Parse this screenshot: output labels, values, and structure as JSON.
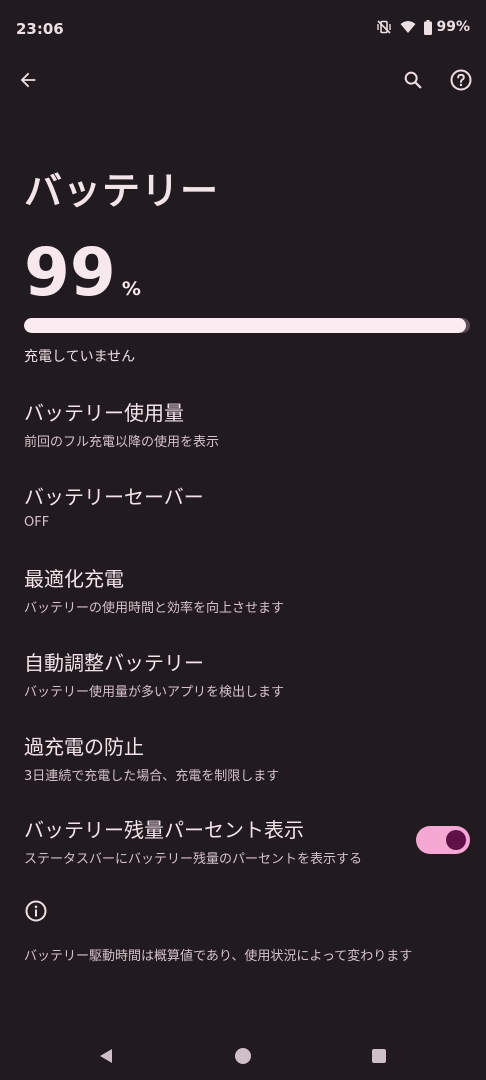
{
  "status_bar": {
    "time": "23:06",
    "battery_percent": "99%",
    "icons": [
      "vibrate-off-icon",
      "wifi-icon",
      "battery-icon"
    ]
  },
  "app_bar": {
    "icons": [
      "back-arrow-icon",
      "search-icon",
      "help-icon"
    ]
  },
  "page": {
    "title": "バッテリー",
    "battery_level": "99",
    "battery_unit": "%",
    "battery_fraction": 0.99,
    "charging_status": "充電していません"
  },
  "settings": [
    {
      "title": "バッテリー使用量",
      "subtitle": "前回のフル充電以降の使用を表示"
    },
    {
      "title": "バッテリーセーバー",
      "subtitle": "OFF"
    },
    {
      "title": "最適化充電",
      "subtitle": "バッテリーの使用時間と効率を向上させます"
    },
    {
      "title": "自動調整バッテリー",
      "subtitle": "バッテリー使用量が多いアプリを検出します"
    },
    {
      "title": "過充電の防止",
      "subtitle": "3日連続で充電した場合、充電を制限します"
    },
    {
      "title": "バッテリー残量パーセント表示",
      "subtitle": "ステータスバーにバッテリー残量のパーセントを表示する",
      "toggle_on": true
    }
  ],
  "footer": {
    "text": "バッテリー駆動時間は概算値であり、使用状況によって変わります"
  },
  "colors": {
    "background": "#211a1e",
    "toggle_track": "#f5a8d4",
    "toggle_knob": "#5f1148",
    "bar_fill": "#fbecf2"
  }
}
